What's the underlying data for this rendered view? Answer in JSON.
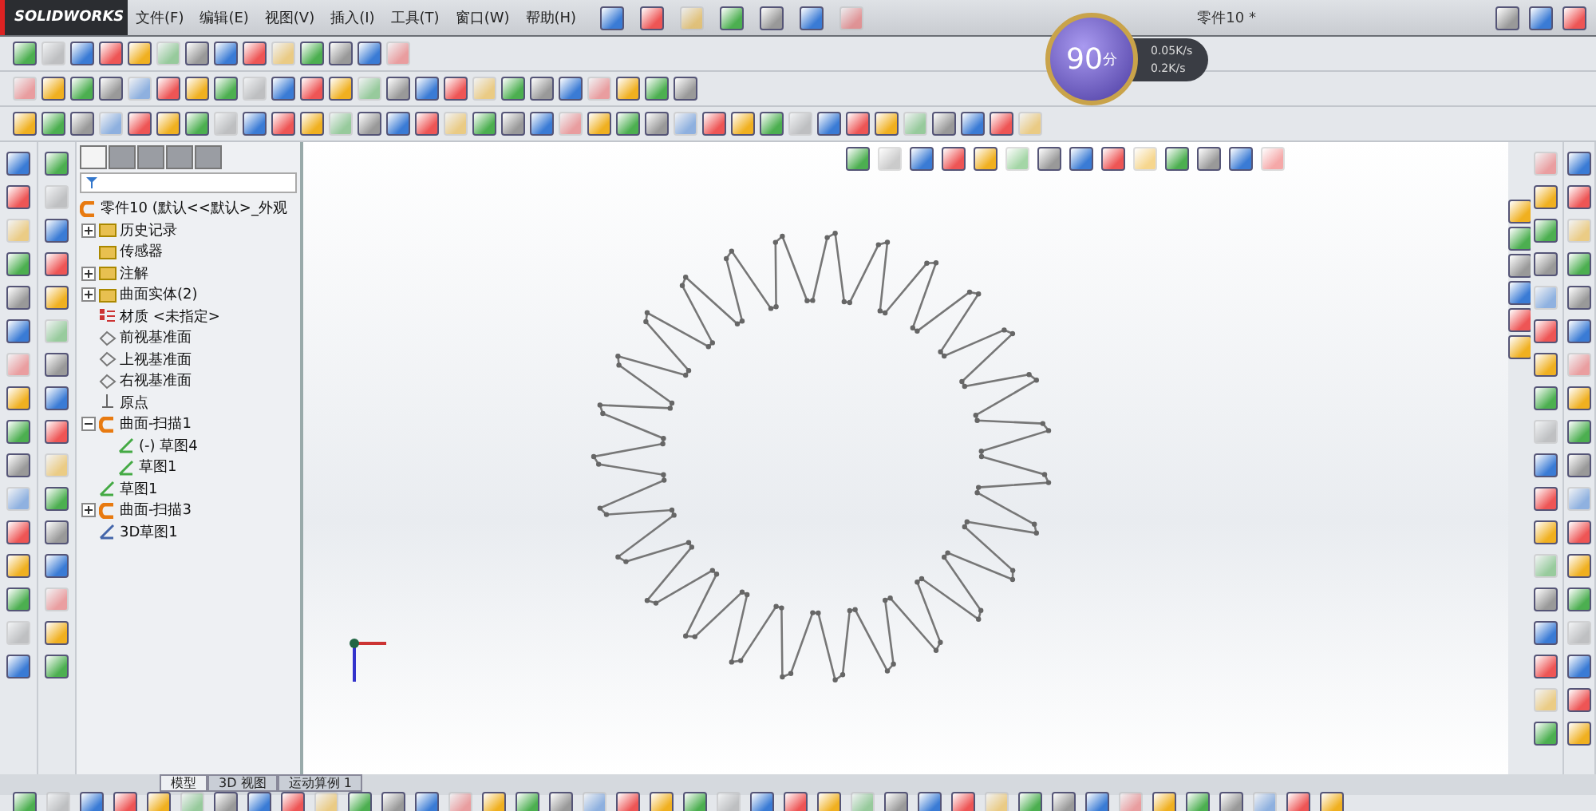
{
  "app": {
    "logo": "SOLIDWORKS"
  },
  "menu": [
    "文件(F)",
    "编辑(E)",
    "视图(V)",
    "插入(I)",
    "工具(T)",
    "窗口(W)",
    "帮助(H)"
  ],
  "window": {
    "title": "零件10 *"
  },
  "speed_widget": {
    "score": "90",
    "unit": "分",
    "upload": "0.05K/s",
    "download": "0.2K/s"
  },
  "panel_tabs": [
    {
      "selected": true
    },
    {
      "selected": false
    },
    {
      "selected": false
    },
    {
      "selected": false
    },
    {
      "selected": false
    }
  ],
  "feature_tree": {
    "root": "零件10  (默认<<默认>_外观",
    "items": [
      {
        "label": "历史记录",
        "kind": "folder",
        "expanded": false
      },
      {
        "label": "传感器",
        "kind": "folder"
      },
      {
        "label": "注解",
        "kind": "folder",
        "expanded": false
      },
      {
        "label": "曲面实体(2)",
        "kind": "folder",
        "expanded": false
      },
      {
        "label": "材质 <未指定>",
        "kind": "material"
      },
      {
        "label": "前视基准面",
        "kind": "plane"
      },
      {
        "label": "上视基准面",
        "kind": "plane"
      },
      {
        "label": "右视基准面",
        "kind": "plane"
      },
      {
        "label": "原点",
        "kind": "origin"
      },
      {
        "label": "曲面-扫描1",
        "kind": "sweep",
        "expanded": true,
        "children": [
          {
            "label": "(-) 草图4",
            "kind": "sketch"
          },
          {
            "label": "草图1",
            "kind": "sketch"
          }
        ]
      },
      {
        "label": "草图1",
        "kind": "sketch"
      },
      {
        "label": "曲面-扫描3",
        "kind": "sweep",
        "expanded": false
      },
      {
        "label": "3D草图1",
        "kind": "sketch3d"
      }
    ]
  },
  "view_tabs": [
    {
      "label": "模型",
      "selected": true
    },
    {
      "label": "3D 视图",
      "selected": false
    },
    {
      "label": "运动算例 1",
      "selected": false
    }
  ]
}
